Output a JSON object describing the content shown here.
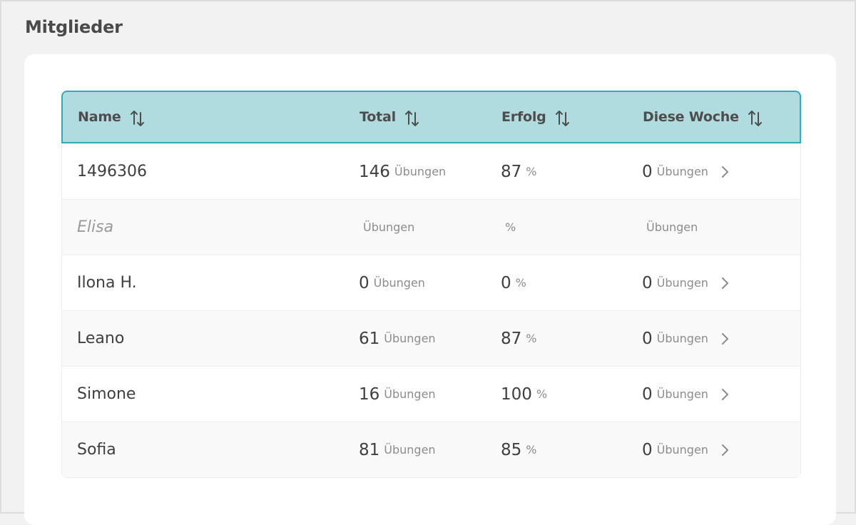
{
  "page": {
    "title": "Mitglieder"
  },
  "table": {
    "headers": {
      "name": "Name",
      "total": "Total",
      "erfolg": "Erfolg",
      "woche": "Diese Woche"
    },
    "header_color": "#b0dcdf",
    "accent_color": "#2cadb9",
    "units": {
      "exercises": "Übungen",
      "percent": "%"
    },
    "rows": [
      {
        "name": "1496306",
        "total": "146",
        "total_unit": "Übungen",
        "erfolg": "87",
        "erfolg_unit": "%",
        "woche": "0",
        "woche_unit": "Übungen",
        "has_chevron": true
      },
      {
        "name": "Elisa",
        "total": "",
        "total_unit": "Übungen",
        "erfolg": "",
        "erfolg_unit": "%",
        "woche": "",
        "woche_unit": "Übungen",
        "has_chevron": false
      },
      {
        "name": "Ilona H.",
        "total": "0",
        "total_unit": "Übungen",
        "erfolg": "0",
        "erfolg_unit": "%",
        "woche": "0",
        "woche_unit": "Übungen",
        "has_chevron": true
      },
      {
        "name": "Leano",
        "total": "61",
        "total_unit": "Übungen",
        "erfolg": "87",
        "erfolg_unit": "%",
        "woche": "0",
        "woche_unit": "Übungen",
        "has_chevron": true
      },
      {
        "name": "Simone",
        "total": "16",
        "total_unit": "Übungen",
        "erfolg": "100",
        "erfolg_unit": "%",
        "woche": "0",
        "woche_unit": "Übungen",
        "has_chevron": true
      },
      {
        "name": "Sofia",
        "total": "81",
        "total_unit": "Übungen",
        "erfolg": "85",
        "erfolg_unit": "%",
        "woche": "0",
        "woche_unit": "Übungen",
        "has_chevron": true
      }
    ]
  },
  "icons": {
    "sort": "sort-updown-icon",
    "chevron": "chevron-right-icon"
  }
}
